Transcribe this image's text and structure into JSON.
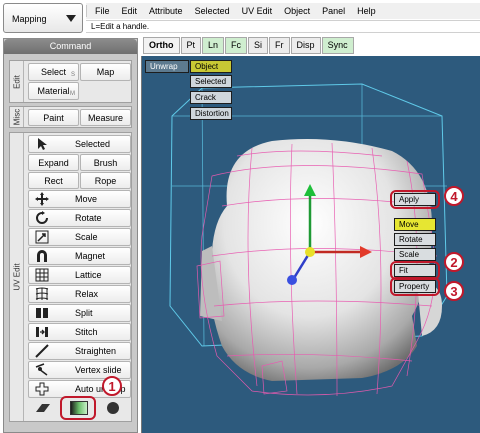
{
  "mode": {
    "label": "Mapping"
  },
  "menu": [
    "File",
    "Edit",
    "Attribute",
    "Selected",
    "UV Edit",
    "Object",
    "Panel",
    "Help"
  ],
  "hint": "L=Edit a handle.",
  "command": {
    "title": "Command",
    "edit_group": {
      "tab": "Edit",
      "select": "Select",
      "select_sub": "S",
      "map": "Map",
      "material": "Material",
      "material_sub": "M"
    },
    "misc_group": {
      "tab": "Misc",
      "paint": "Paint",
      "measure": "Measure"
    },
    "uvedit_group": {
      "tab": "UV Edit",
      "selected": "Selected",
      "expand": "Expand",
      "brush": "Brush",
      "rect": "Rect",
      "rope": "Rope",
      "move": "Move",
      "rotate": "Rotate",
      "scale": "Scale",
      "magnet": "Magnet",
      "lattice": "Lattice",
      "relax": "Relax",
      "split": "Split",
      "stitch": "Stitch",
      "straighten": "Straighten",
      "vertex_slide": "Vertex slide",
      "auto_unwrap": "Auto unwrap"
    }
  },
  "view_tabs": [
    {
      "label": "Ortho",
      "state": "bold"
    },
    {
      "label": "Pt",
      "state": "off"
    },
    {
      "label": "Ln",
      "state": "on"
    },
    {
      "label": "Fc",
      "state": "on"
    },
    {
      "label": "Si",
      "state": "off"
    },
    {
      "label": "Fr",
      "state": "off"
    },
    {
      "label": "Disp",
      "state": "off"
    },
    {
      "label": "Sync",
      "state": "on"
    }
  ],
  "viewport": {
    "unwrap": "Unwrap",
    "object": "Object",
    "selected": "Selected",
    "crack": "Crack",
    "distortion": "Distortion",
    "apply": "Apply",
    "move": "Move",
    "rotate": "Rotate",
    "scale": "Scale",
    "fit": "Fit",
    "property": "Property"
  },
  "callouts": [
    "1",
    "2",
    "3",
    "4"
  ],
  "colors": {
    "viewport_bg": "#2d5a7d",
    "highlight": "#c0182b",
    "active_yellow": "#e6e632",
    "tab_on": "#cfeecf"
  }
}
